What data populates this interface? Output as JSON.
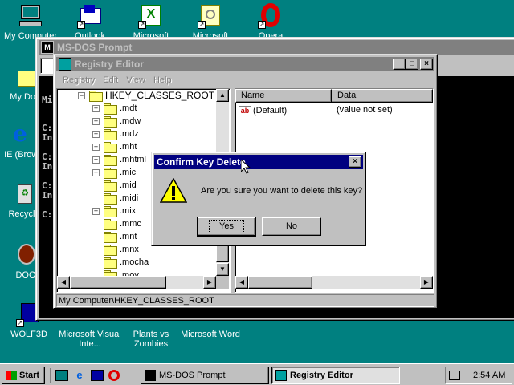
{
  "desktop": {
    "icons": [
      {
        "label": "My Computer"
      },
      {
        "label": "My Docu"
      },
      {
        "label": "IE (Browse"
      },
      {
        "label": "Recycle"
      },
      {
        "label": "DOO"
      },
      {
        "label": "WOLF3D"
      },
      {
        "label": "Microsoft Visual Inte..."
      },
      {
        "label": "Plants vs Zombies"
      },
      {
        "label": "Microsoft Word"
      }
    ],
    "top_icons": [
      {
        "label": "Outlook"
      },
      {
        "label": "Microsoft"
      },
      {
        "label": "Microsoft"
      },
      {
        "label": "Opera"
      }
    ]
  },
  "msdos": {
    "title": "MS-DOS Prompt",
    "lines": [
      "Mi",
      "C:",
      "In",
      "C:",
      "In",
      "C:",
      "In",
      "C:"
    ]
  },
  "regedit": {
    "title": "Registry Editor",
    "menu": [
      "Registry",
      "Edit",
      "View",
      "Help"
    ],
    "tree_root": "HKEY_CLASSES_ROOT",
    "tree_items": [
      {
        "name": ".mdt",
        "expandable": true
      },
      {
        "name": ".mdw",
        "expandable": true
      },
      {
        "name": ".mdz",
        "expandable": true
      },
      {
        "name": ".mht",
        "expandable": true
      },
      {
        "name": ".mhtml",
        "expandable": true
      },
      {
        "name": ".mic",
        "expandable": true
      },
      {
        "name": ".mid",
        "expandable": false
      },
      {
        "name": ".midi",
        "expandable": false
      },
      {
        "name": ".mix",
        "expandable": true
      },
      {
        "name": ".mmc",
        "expandable": false
      },
      {
        "name": ".mnt",
        "expandable": false
      },
      {
        "name": ".mnx",
        "expandable": false
      },
      {
        "name": ".mocha",
        "expandable": false
      },
      {
        "name": ".mov",
        "expandable": false
      }
    ],
    "columns": {
      "name": "Name",
      "data": "Data"
    },
    "values": [
      {
        "name": "(Default)",
        "data": "(value not set)",
        "icon": "ab"
      }
    ],
    "status": "My Computer\\HKEY_CLASSES_ROOT"
  },
  "dialog": {
    "title": "Confirm Key Delete",
    "message": "Are you sure you want to delete this key?",
    "yes_label": "Yes",
    "no_label": "No",
    "icon": "warning-icon"
  },
  "taskbar": {
    "start_label": "Start",
    "tasks": [
      {
        "label": "MS-DOS Prompt",
        "active": false
      },
      {
        "label": "Registry Editor",
        "active": true
      }
    ],
    "clock": "2:54 AM"
  }
}
